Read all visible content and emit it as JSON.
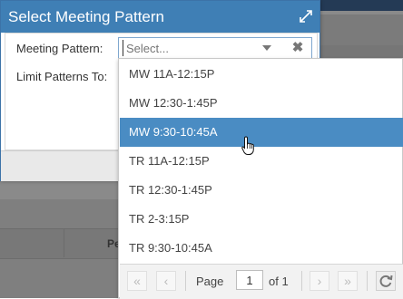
{
  "dialog": {
    "title": "Select Meeting Pattern",
    "meeting_pattern_label": "Meeting Pattern:",
    "limit_patterns_label": "Limit Patterns To:"
  },
  "combo": {
    "placeholder": "Select...",
    "clear_symbol": "✖"
  },
  "options": [
    {
      "label": "MW 11A-12:15P",
      "selected": false
    },
    {
      "label": "MW 12:30-1:45P",
      "selected": false
    },
    {
      "label": "MW 9:30-10:45A",
      "selected": true
    },
    {
      "label": "TR 11A-12:15P",
      "selected": false
    },
    {
      "label": "TR 12:30-1:45P",
      "selected": false
    },
    {
      "label": "TR 2-3:15P",
      "selected": false
    },
    {
      "label": "TR 9:30-10:45A",
      "selected": false
    }
  ],
  "pager": {
    "page_label": "Page",
    "page_value": "1",
    "of_label": "of 1",
    "first": "«",
    "prev": "‹",
    "next": "›",
    "last": "»"
  },
  "background": {
    "column_header": "Pe"
  },
  "colors": {
    "header": "#3f7fb5",
    "selected": "#4a8cc3"
  }
}
